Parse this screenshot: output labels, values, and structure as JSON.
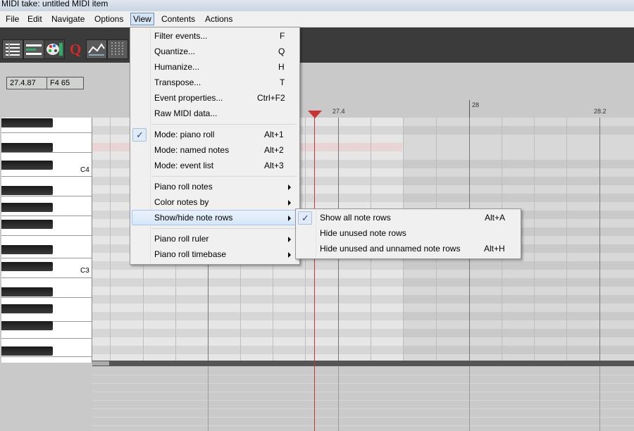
{
  "window": {
    "title": "MIDI take: untitled MIDI item"
  },
  "menubar": [
    "File",
    "Edit",
    "Navigate",
    "Options",
    "View",
    "Contents",
    "Actions"
  ],
  "toolbar": {
    "icons": [
      "event-list-icon",
      "piano-roll-icon",
      "palette-icon",
      "quantize-icon",
      "humanize-icon",
      "grid-icon"
    ],
    "quantize_glyph": "Q"
  },
  "info": {
    "position": "27.4.87",
    "note": "F4  65"
  },
  "ruler": {
    "labels": [
      "27.4",
      "28",
      "28.2"
    ]
  },
  "keys": {
    "labels": [
      "C4",
      "C3"
    ]
  },
  "view_menu": {
    "items": [
      {
        "label": "Filter events...",
        "shortcut": "F"
      },
      {
        "label": "Quantize...",
        "shortcut": "Q"
      },
      {
        "label": "Humanize...",
        "shortcut": "H"
      },
      {
        "label": "Transpose...",
        "shortcut": "T"
      },
      {
        "label": "Event properties...",
        "shortcut": "Ctrl+F2"
      },
      {
        "label": "Raw MIDI data...",
        "shortcut": ""
      },
      {
        "label": "Mode: piano roll",
        "shortcut": "Alt+1",
        "checked": true
      },
      {
        "label": "Mode: named notes",
        "shortcut": "Alt+2"
      },
      {
        "label": "Mode: event list",
        "shortcut": "Alt+3"
      },
      {
        "label": "Piano roll notes",
        "submenu": true
      },
      {
        "label": "Color notes by",
        "submenu": true
      },
      {
        "label": "Show/hide note rows",
        "submenu": true,
        "highlighted": true
      },
      {
        "label": "Piano roll ruler",
        "submenu": true
      },
      {
        "label": "Piano roll timebase",
        "submenu": true
      }
    ]
  },
  "notes_submenu": {
    "items": [
      {
        "label": "Show all note rows",
        "shortcut": "Alt+A",
        "checked": true
      },
      {
        "label": "Hide unused note rows",
        "shortcut": ""
      },
      {
        "label": "Hide unused and unnamed note rows",
        "shortcut": "Alt+H"
      }
    ]
  },
  "check_glyph": "✓",
  "colors": {
    "playhead": "#c83434",
    "toolbar_bg": "#3b3b3b",
    "check": "#1b4c9b"
  }
}
